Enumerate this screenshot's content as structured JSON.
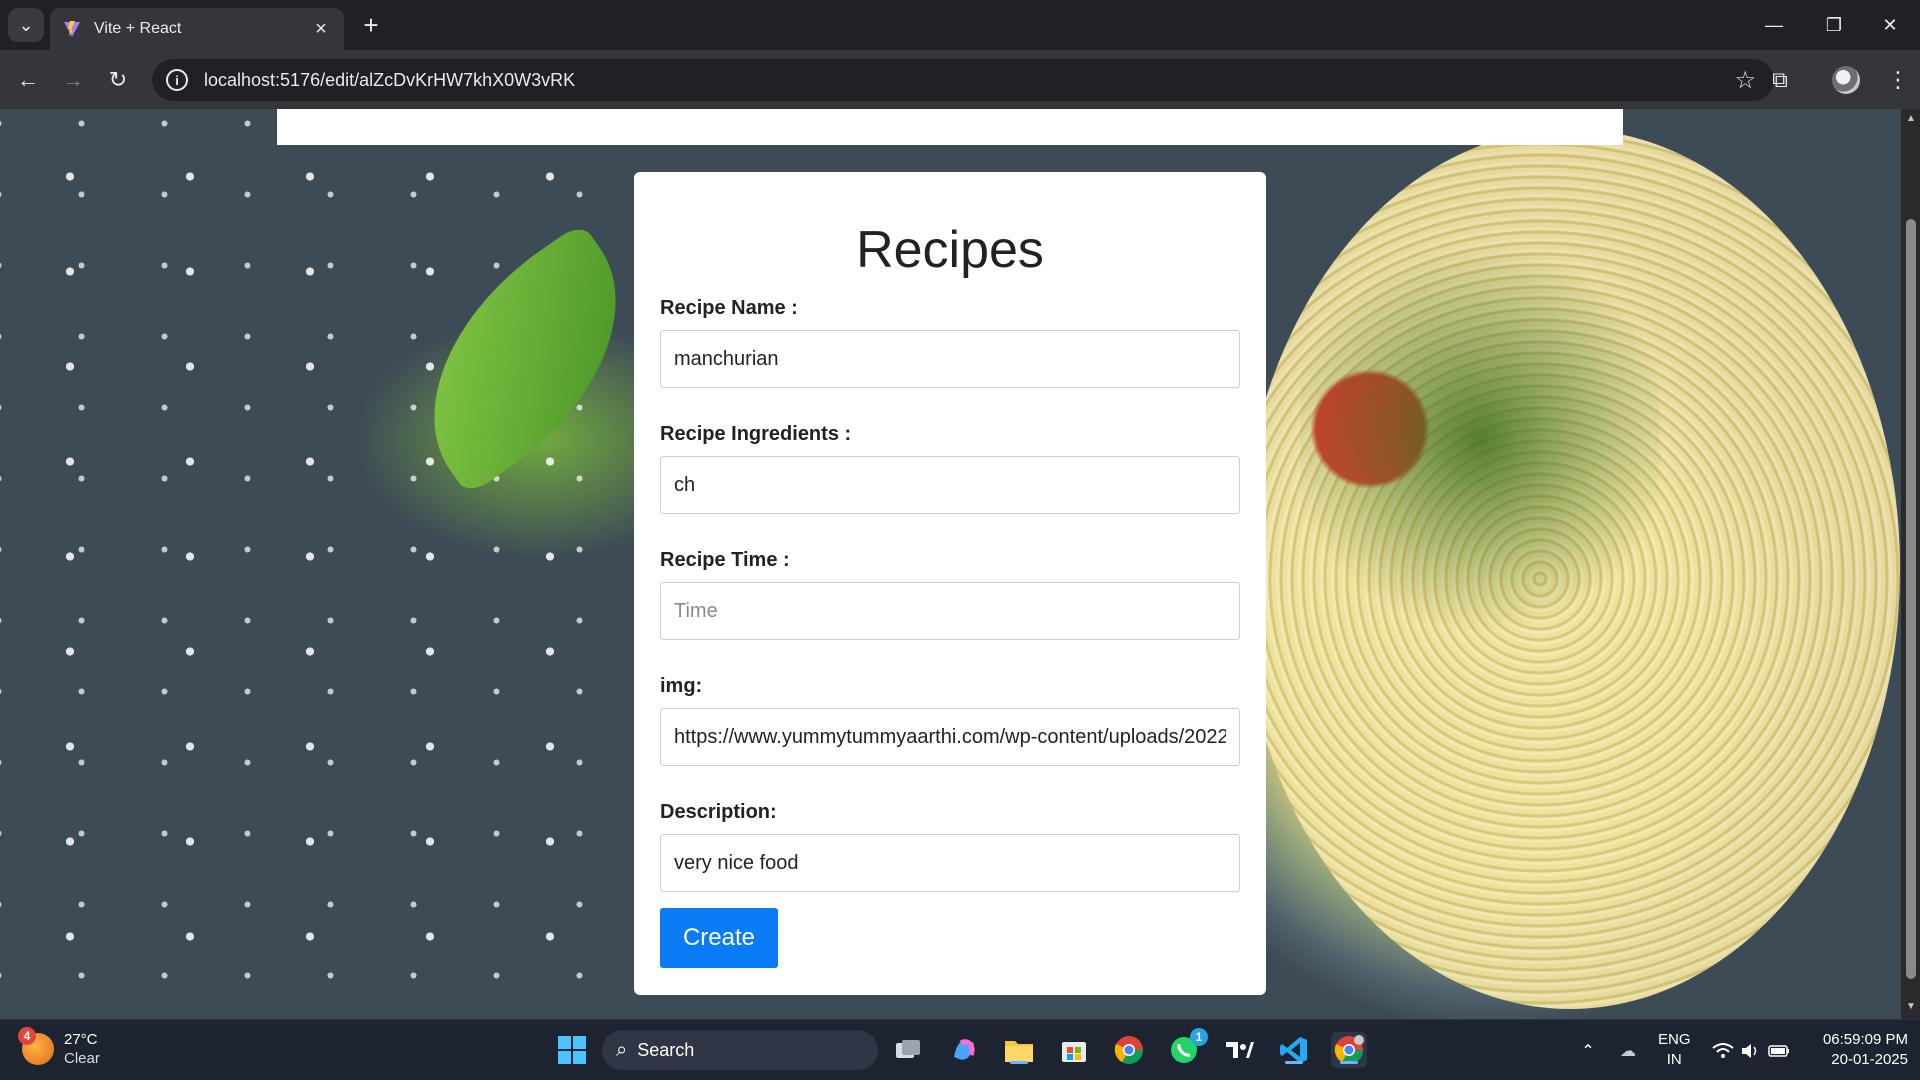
{
  "browser": {
    "tab_title": "Vite + React",
    "url": "localhost:5176/edit/alZcDvKrHW7khX0W3vRK"
  },
  "page": {
    "heading": "Recipes",
    "fields": {
      "name": {
        "label": "Recipe Name :",
        "value": "manchurian",
        "placeholder": ""
      },
      "ingredients": {
        "label": "Recipe Ingredients :",
        "value": "ch",
        "placeholder": ""
      },
      "time": {
        "label": "Recipe Time :",
        "value": "",
        "placeholder": "Time"
      },
      "img": {
        "label": "img:",
        "value": "https://www.yummytummyaarthi.com/wp-content/uploads/2022",
        "placeholder": ""
      },
      "description": {
        "label": "Description:",
        "value": "very nice food",
        "placeholder": ""
      }
    },
    "create_button": "Create"
  },
  "taskbar": {
    "weather_badge": "4",
    "temperature": "27°C",
    "condition": "Clear",
    "search_label": "Search",
    "whatsapp_badge": "1",
    "lang_top": "ENG",
    "lang_bottom": "IN",
    "time": "06:59:09 PM",
    "date": "20-01-2025"
  },
  "colors": {
    "primary_button": "#0b7cf6",
    "browser_chrome": "#35363a",
    "taskbar": "#1d2431"
  }
}
